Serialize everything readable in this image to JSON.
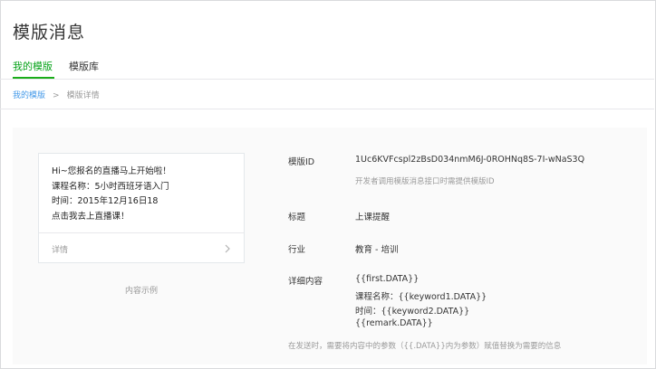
{
  "page": {
    "title": "模版消息"
  },
  "tabs": [
    {
      "label": "我的模版",
      "active": true
    },
    {
      "label": "模版库",
      "active": false
    }
  ],
  "breadcrumb": {
    "link": "我的模版",
    "separator": ">",
    "current": "模版详情"
  },
  "preview": {
    "lines": [
      "Hi~您报名的直播马上开始啦！",
      "课程名称：5小时西班牙语入门",
      "时间：2015年12月16日18",
      "点击我去上直播课！"
    ],
    "footer_label": "详情",
    "caption": "内容示例"
  },
  "details": {
    "template_id_label": "模版ID",
    "template_id_value": "1Uc6KVFcspl2zBsD034nmM6J-0ROHNq8S-7I-wNaS3Q",
    "template_id_hint": "开发者调用模版消息接口时需提供模版ID",
    "title_label": "标题",
    "title_value": "上课提醒",
    "industry_label": "行业",
    "industry_value": "教育 - 培训",
    "content_label": "详细内容",
    "content_lines": [
      "{{first.DATA}}",
      "课程名称：{{keyword1.DATA}}",
      "时间：{{keyword2.DATA}}",
      "{{remark.DATA}}"
    ],
    "note": "在发送时，需要将内容中的参数（{{.DATA}}内为参数）赋值替换为需要的信息"
  },
  "colors": {
    "accent": "#1aad19",
    "link": "#459ae9",
    "muted": "#9a9a9a"
  },
  "icons": {
    "chevron": "chevron-right-icon"
  }
}
